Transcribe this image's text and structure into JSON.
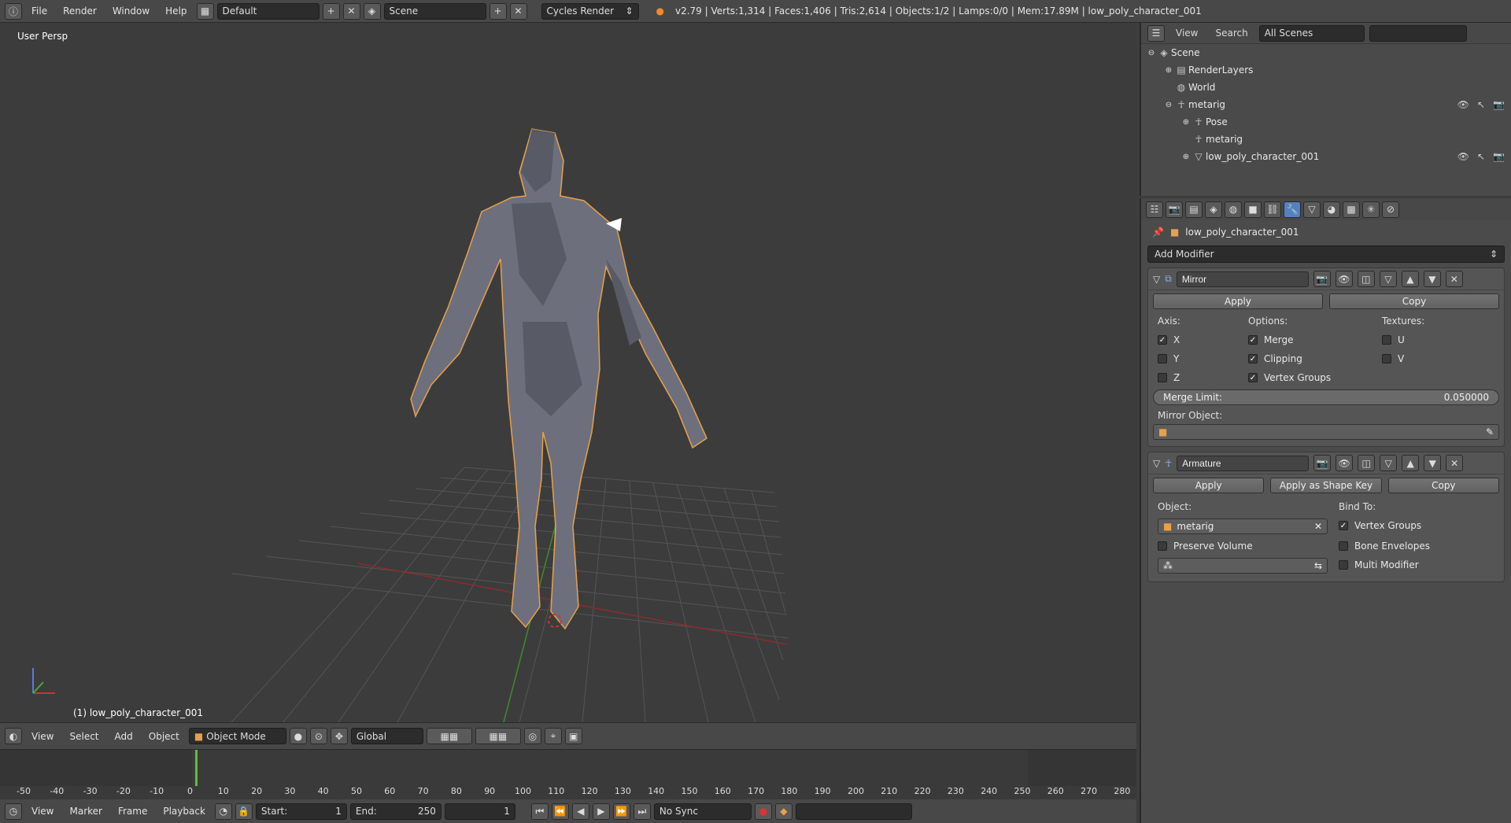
{
  "topbar": {
    "menus": [
      "File",
      "Render",
      "Window",
      "Help"
    ],
    "layout": "Default",
    "scene": "Scene",
    "engine": "Cycles Render",
    "stats": "v2.79 | Verts:1,314 | Faces:1,406 | Tris:2,614 | Objects:1/2 | Lamps:0/0 | Mem:17.89M | low_poly_character_001"
  },
  "viewport": {
    "label": "User Persp",
    "object_label": "(1) low_poly_character_001"
  },
  "viewport_header": {
    "menus": [
      "View",
      "Select",
      "Add",
      "Object"
    ],
    "mode": "Object Mode",
    "orientation": "Global"
  },
  "timeline": {
    "ticks": [
      "-50",
      "-40",
      "-30",
      "-20",
      "-10",
      "0",
      "10",
      "20",
      "30",
      "40",
      "50",
      "60",
      "70",
      "80",
      "90",
      "100",
      "110",
      "120",
      "130",
      "140",
      "150",
      "160",
      "170",
      "180",
      "190",
      "200",
      "210",
      "220",
      "230",
      "240",
      "250",
      "260",
      "270",
      "280"
    ],
    "current_frame_tick": "0"
  },
  "timeline_header": {
    "menus": [
      "View",
      "Marker",
      "Frame",
      "Playback"
    ],
    "start_label": "Start:",
    "start_value": "1",
    "end_label": "End:",
    "end_value": "250",
    "current": "1",
    "sync": "No Sync"
  },
  "outliner": {
    "menus": [
      "View",
      "Search"
    ],
    "filter": "All Scenes",
    "search_placeholder": "",
    "items": [
      {
        "label": "Scene",
        "depth": 0,
        "expand": "⊖",
        "icon": "scene-icon"
      },
      {
        "label": "RenderLayers",
        "depth": 1,
        "expand": "⊕",
        "icon": "renderlayers-icon"
      },
      {
        "label": "World",
        "depth": 1,
        "expand": "",
        "icon": "world-icon"
      },
      {
        "label": "metarig",
        "depth": 1,
        "expand": "⊖",
        "icon": "armature-icon"
      },
      {
        "label": "Pose",
        "depth": 2,
        "expand": "⊕",
        "icon": "pose-icon"
      },
      {
        "label": "metarig",
        "depth": 2,
        "expand": "",
        "icon": "armature-data-icon"
      },
      {
        "label": "low_poly_character_001",
        "depth": 2,
        "expand": "⊕",
        "icon": "mesh-icon"
      }
    ]
  },
  "properties": {
    "context_object": "low_poly_character_001",
    "add_modifier": "Add Modifier",
    "mirror": {
      "name": "Mirror",
      "apply": "Apply",
      "copy": "Copy",
      "axis_label": "Axis:",
      "options_label": "Options:",
      "textures_label": "Textures:",
      "axes": [
        {
          "label": "X",
          "checked": true
        },
        {
          "label": "Y",
          "checked": false
        },
        {
          "label": "Z",
          "checked": false
        }
      ],
      "options": [
        {
          "label": "Merge",
          "checked": true
        },
        {
          "label": "Clipping",
          "checked": true
        },
        {
          "label": "Vertex Groups",
          "checked": true
        }
      ],
      "textures": [
        {
          "label": "U",
          "checked": false
        },
        {
          "label": "V",
          "checked": false
        }
      ],
      "merge_limit_label": "Merge Limit:",
      "merge_limit_value": "0.050000",
      "mirror_object_label": "Mirror Object:"
    },
    "armature": {
      "name": "Armature",
      "apply": "Apply",
      "apply_shape": "Apply as Shape Key",
      "copy": "Copy",
      "object_label": "Object:",
      "object_value": "metarig",
      "bind_label": "Bind To:",
      "preserve_volume": "Preserve Volume",
      "vertex_groups": "Vertex Groups",
      "bone_envelopes": "Bone Envelopes",
      "multi_modifier": "Multi Modifier",
      "preserve_checked": false,
      "vg_checked": true,
      "be_checked": false,
      "mm_checked": false
    }
  }
}
